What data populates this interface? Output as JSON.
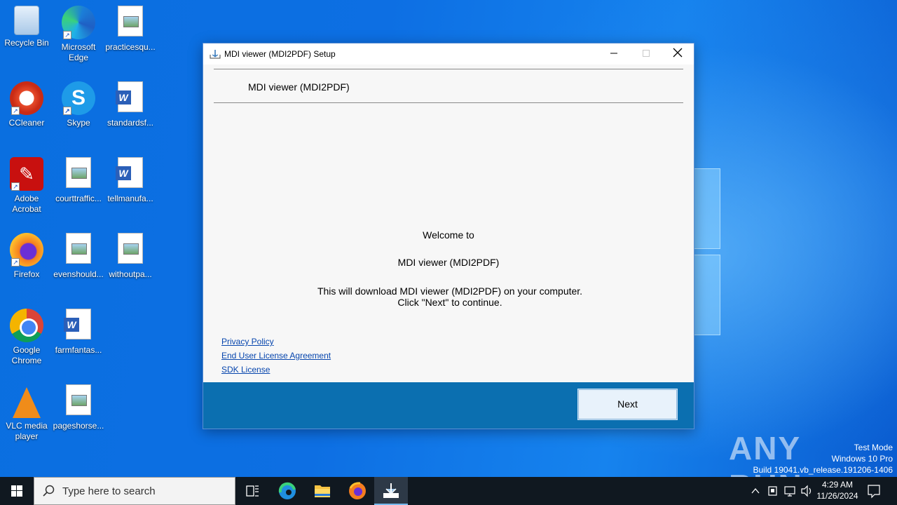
{
  "desktop": {
    "icons": [
      {
        "label": "Recycle Bin"
      },
      {
        "label": "Microsoft Edge"
      },
      {
        "label": "practicesqu..."
      },
      {
        "label": "CCleaner"
      },
      {
        "label": "Skype"
      },
      {
        "label": "standardsf..."
      },
      {
        "label": "Adobe Acrobat"
      },
      {
        "label": "courttraffic..."
      },
      {
        "label": "tellmanufa..."
      },
      {
        "label": "Firefox"
      },
      {
        "label": "evenshould..."
      },
      {
        "label": "withoutpa..."
      },
      {
        "label": "Google Chrome"
      },
      {
        "label": "farmfantas..."
      },
      {
        "label": "VLC media player"
      },
      {
        "label": "pageshorse..."
      }
    ],
    "watermark": "ANY RUN",
    "test_mode": [
      "Test Mode",
      "Windows 10 Pro",
      "Build 19041.vb_release.191206-1406"
    ]
  },
  "window": {
    "title": "MDI viewer (MDI2PDF) Setup",
    "header": "MDI viewer (MDI2PDF)",
    "welcome": "Welcome to",
    "product": "MDI viewer (MDI2PDF)",
    "line1": "This will download MDI viewer (MDI2PDF) on your computer.",
    "line2": "Click \"Next\" to continue.",
    "links": [
      "Privacy Policy",
      "End User License Agreement",
      "SDK License"
    ],
    "next_label": "Next",
    "accent": "#0b6fb0"
  },
  "taskbar": {
    "search_placeholder": "Type here to search",
    "time": "4:29 AM",
    "date": "11/26/2024"
  }
}
